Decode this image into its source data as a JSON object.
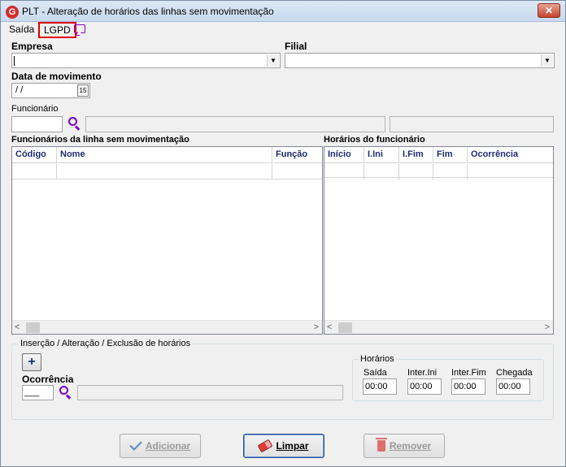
{
  "window": {
    "title": "PLT - Alteração de horários das linhas sem movimentação",
    "close_glyph": "✕"
  },
  "menu": {
    "saida": "Saída",
    "lgpd": "LGPD",
    "chat_icon": "chat-icon"
  },
  "form": {
    "empresa_label": "Empresa",
    "filial_label": "Filial",
    "data_label": "Data de movimento",
    "data_value": " / /",
    "funcionario_label": "Funcionário"
  },
  "grid_left": {
    "title": "Funcionários da linha sem movimentação",
    "columns": [
      "Código",
      "Nome",
      "Função"
    ]
  },
  "grid_right": {
    "title": "Horários do funcionário",
    "columns": [
      "Início",
      "I.Ini",
      "I.Fim",
      "Fim",
      "Ocorrência"
    ]
  },
  "insercao": {
    "title": "Inserção / Alteração / Exclusão de horários",
    "add_glyph": "+",
    "ocorrencia_label": "Ocorrência",
    "ocorrencia_value": "___"
  },
  "horarios": {
    "title": "Horários",
    "labels": [
      "Saída",
      "Inter.Ini",
      "Inter.Fim",
      "Chegada"
    ],
    "values": [
      "00:00",
      "00:00",
      "00:00",
      "00:00"
    ]
  },
  "buttons": {
    "adicionar": "Adicionar",
    "limpar": "Limpar",
    "remover": "Remover"
  },
  "scroll": {
    "left": "<",
    "right": ">"
  },
  "calendar_glyph": "15",
  "combo_arrow": "▼"
}
